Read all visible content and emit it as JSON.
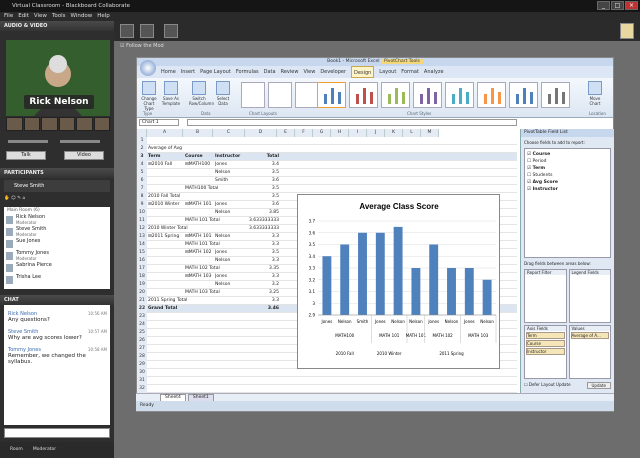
{
  "window": {
    "title": "Virtual Classroom - Blackboard Collaborate"
  },
  "menu": [
    "File",
    "Edit",
    "View",
    "Tools",
    "Window",
    "Help"
  ],
  "av": {
    "header": "AUDIO & VIDEO",
    "speaker_name": "Rick Nelson",
    "talk": "Talk",
    "video": "Video"
  },
  "participants": {
    "header": "PARTICIPANTS",
    "self": "Steve Smith",
    "room_label": "Main Room (6)",
    "list": [
      {
        "name": "Rick Nelson",
        "role": "Moderator"
      },
      {
        "name": "Steve Smith",
        "role": "Moderator"
      },
      {
        "name": "Sue Jones",
        "role": ""
      },
      {
        "name": "Tommy Jones",
        "role": "Moderator"
      },
      {
        "name": "Sabrina Pierce",
        "role": ""
      },
      {
        "name": "Trisha Lee",
        "role": ""
      }
    ]
  },
  "chat": {
    "header": "CHAT",
    "messages": [
      {
        "name": "Rick Nelson",
        "time": "10:56 AM",
        "text": "Any questions?"
      },
      {
        "name": "Steve Smith",
        "time": "10:57 AM",
        "text": "Why are avg scores lower?"
      },
      {
        "name": "Tommy Jones",
        "time": "10:58 AM",
        "text": "Remember, we changed the syllabus."
      }
    ],
    "tabs": [
      "Room",
      "Moderator"
    ]
  },
  "toolbar": {
    "follow_label": "Follow the Mod"
  },
  "excel": {
    "title": "Book1 - Microsoft Excel",
    "tools_label": "PivotChart Tools",
    "tabs": [
      "Home",
      "Insert",
      "Page Layout",
      "Formulas",
      "Data",
      "Review",
      "View",
      "Developer",
      "Design",
      "Layout",
      "Format",
      "Analyze"
    ],
    "active_tab": "Design",
    "ribbon_buttons": [
      "Change Chart Type",
      "Save As Template",
      "Switch Row/Column",
      "Select Data",
      "Move Chart"
    ],
    "ribbon_groups": [
      "Type",
      "Data",
      "Chart Layouts",
      "Chart Styles",
      "Location"
    ],
    "namebox": "Chart 1",
    "columns": [
      "A",
      "B",
      "C",
      "D",
      "E",
      "F",
      "G",
      "H",
      "I",
      "J",
      "K",
      "L",
      "M"
    ],
    "rows": [
      {
        "n": "1",
        "a": "",
        "b": "",
        "c": "",
        "d": ""
      },
      {
        "n": "2",
        "a": "Average of Avg",
        "b": "",
        "c": "",
        "d": ""
      },
      {
        "n": "3",
        "a": "Term",
        "b": "Course",
        "c": "Instructor",
        "d": "Total"
      },
      {
        "n": "4",
        "a": "⊟2010 Fall",
        "b": "⊟MATH100",
        "c": "Jones",
        "d": "3.4"
      },
      {
        "n": "5",
        "a": "",
        "b": "",
        "c": "Nelson",
        "d": "3.5"
      },
      {
        "n": "6",
        "a": "",
        "b": "",
        "c": "Smith",
        "d": "3.6"
      },
      {
        "n": "7",
        "a": "",
        "b": "MATH100 Total",
        "c": "",
        "d": "3.5"
      },
      {
        "n": "8",
        "a": "2010 Fall Total",
        "b": "",
        "c": "",
        "d": "3.5"
      },
      {
        "n": "9",
        "a": "⊟2010 Winter",
        "b": "⊟MATH 101",
        "c": "Jones",
        "d": "3.6"
      },
      {
        "n": "10",
        "a": "",
        "b": "",
        "c": "Nelson",
        "d": "3.85"
      },
      {
        "n": "11",
        "a": "",
        "b": "MATH 101 Total",
        "c": "",
        "d": "3.633333333"
      },
      {
        "n": "12",
        "a": "2010 Winter Total",
        "b": "",
        "c": "",
        "d": "3.633333333"
      },
      {
        "n": "13",
        "a": "⊟2011 Spring",
        "b": "⊟MATH 101",
        "c": "Nelson",
        "d": "3.3"
      },
      {
        "n": "14",
        "a": "",
        "b": "MATH 101 Total",
        "c": "",
        "d": "3.3"
      },
      {
        "n": "15",
        "a": "",
        "b": "⊟MATH 102",
        "c": "Jones",
        "d": "3.5"
      },
      {
        "n": "16",
        "a": "",
        "b": "",
        "c": "Nelson",
        "d": "3.3"
      },
      {
        "n": "17",
        "a": "",
        "b": "MATH 102 Total",
        "c": "",
        "d": "3.35"
      },
      {
        "n": "18",
        "a": "",
        "b": "⊟MATH 103",
        "c": "Jones",
        "d": "3.3"
      },
      {
        "n": "19",
        "a": "",
        "b": "",
        "c": "Nelson",
        "d": "3.2"
      },
      {
        "n": "20",
        "a": "",
        "b": "MATH 103 Total",
        "c": "",
        "d": "3.25"
      },
      {
        "n": "21",
        "a": "2011 Spring Total",
        "b": "",
        "c": "",
        "d": "3.3"
      },
      {
        "n": "22",
        "a": "Grand Total",
        "b": "",
        "c": "",
        "d": "3.46"
      },
      {
        "n": "23",
        "a": "",
        "b": "",
        "c": "",
        "d": ""
      },
      {
        "n": "24",
        "a": "",
        "b": "",
        "c": "",
        "d": ""
      },
      {
        "n": "25",
        "a": "",
        "b": "",
        "c": "",
        "d": ""
      },
      {
        "n": "26",
        "a": "",
        "b": "",
        "c": "",
        "d": ""
      },
      {
        "n": "27",
        "a": "",
        "b": "",
        "c": "",
        "d": ""
      },
      {
        "n": "28",
        "a": "",
        "b": "",
        "c": "",
        "d": ""
      },
      {
        "n": "29",
        "a": "",
        "b": "",
        "c": "",
        "d": ""
      },
      {
        "n": "30",
        "a": "",
        "b": "",
        "c": "",
        "d": ""
      },
      {
        "n": "31",
        "a": "",
        "b": "",
        "c": "",
        "d": ""
      },
      {
        "n": "32",
        "a": "",
        "b": "",
        "c": "",
        "d": ""
      },
      {
        "n": "33",
        "a": "",
        "b": "",
        "c": "",
        "d": ""
      }
    ],
    "sheet_tabs": [
      "Sheet4",
      "Sheet1"
    ],
    "status": "Ready",
    "pane": {
      "title": "PivotTable Field List",
      "choose": "Choose fields to add to report:",
      "fields": [
        {
          "name": "Course",
          "checked": true
        },
        {
          "name": "Period",
          "checked": false
        },
        {
          "name": "Term",
          "checked": true
        },
        {
          "name": "Students",
          "checked": false
        },
        {
          "name": "Avg Score",
          "checked": true
        },
        {
          "name": "Instructor",
          "checked": true
        }
      ],
      "drag": "Drag fields between areas below:",
      "report_filter": "Report Filter",
      "legend_fields": "Legend Fields",
      "axis_fields": "Axis Fields",
      "values": "Values",
      "axis_items": [
        "Term",
        "Course",
        "Instructor"
      ],
      "value_item": "Average of A...",
      "defer": "Defer Layout Update",
      "update": "Update"
    }
  },
  "chart_data": {
    "type": "bar",
    "title": "Average Class Score",
    "ylim": [
      2.9,
      3.7
    ],
    "yticks": [
      "2.9",
      "3",
      "3.1",
      "3.2",
      "3.3",
      "3.4",
      "3.5",
      "3.6",
      "3.7"
    ],
    "categories": [
      "Jones",
      "Nelson",
      "Smith",
      "Jones",
      "Nelson",
      "Nelson",
      "Jones",
      "Nelson",
      "Jones",
      "Nelson"
    ],
    "values": [
      3.4,
      3.5,
      3.6,
      3.6,
      3.65,
      3.3,
      3.5,
      3.3,
      3.3,
      3.2
    ],
    "courses": [
      "MATH100",
      "MATH 101",
      "MATH 101",
      "MATH 102",
      "MATH 103"
    ],
    "course_spans": [
      [
        0,
        2
      ],
      [
        3,
        4
      ],
      [
        5,
        5
      ],
      [
        6,
        7
      ],
      [
        8,
        9
      ]
    ],
    "terms": [
      "2010 Fall",
      "2010 Winter",
      "2011 Spring"
    ],
    "term_spans": [
      [
        0,
        2
      ],
      [
        3,
        4
      ],
      [
        5,
        9
      ]
    ],
    "color": "#4f81bd"
  }
}
